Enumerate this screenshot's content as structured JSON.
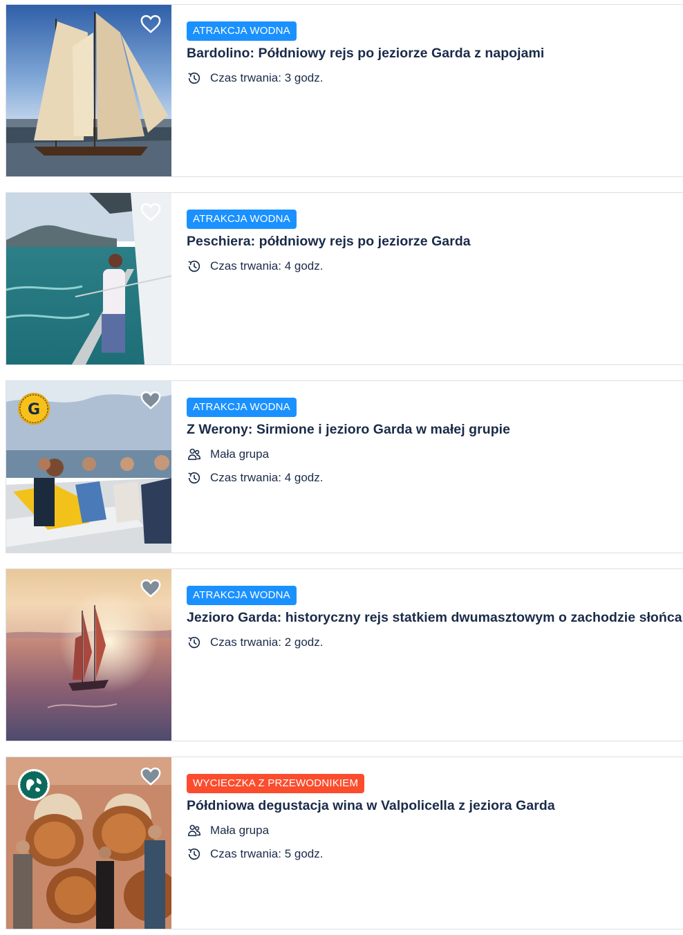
{
  "activities": [
    {
      "tag": "ATRAKCJA WODNA",
      "tag_color": "#1a91ff",
      "title": "Bardolino: Półdniowy rejs po jeziorze Garda z napojami",
      "duration": "Czas trwania: 3 godz.",
      "icon": "heart-icon"
    },
    {
      "tag": "ATRAKCJA WODNA",
      "tag_color": "#1a91ff",
      "title": "Peschiera: półdniowy rejs po jeziorze Garda",
      "duration": "Czas trwania: 4 godz.",
      "icon": "heart-icon"
    },
    {
      "tag": "ATRAKCJA WODNA",
      "tag_color": "#1a91ff",
      "title": "Z Werony: Sirmione i jezioro Garda w małej grupie",
      "group": "Mała grupa",
      "duration": "Czas trwania: 4 godz.",
      "icon": "heart-icon"
    },
    {
      "tag": "ATRAKCJA WODNA",
      "tag_color": "#1a91ff",
      "title": "Jezioro Garda: historyczny rejs statkiem dwumasztowym o zachodzie słońca",
      "duration": "Czas trwania: 2 godz.",
      "icon": "heart-icon"
    },
    {
      "tag": "WYCIECZKA Z PRZEWODNIKIEM",
      "tag_color": "#fb4d2e",
      "title": "Półdniowa degustacja wina w Valpolicella z jeziora Garda",
      "group": "Mała grupa",
      "duration": "Czas trwania: 5 godz.",
      "icon": "heart-icon"
    }
  ]
}
